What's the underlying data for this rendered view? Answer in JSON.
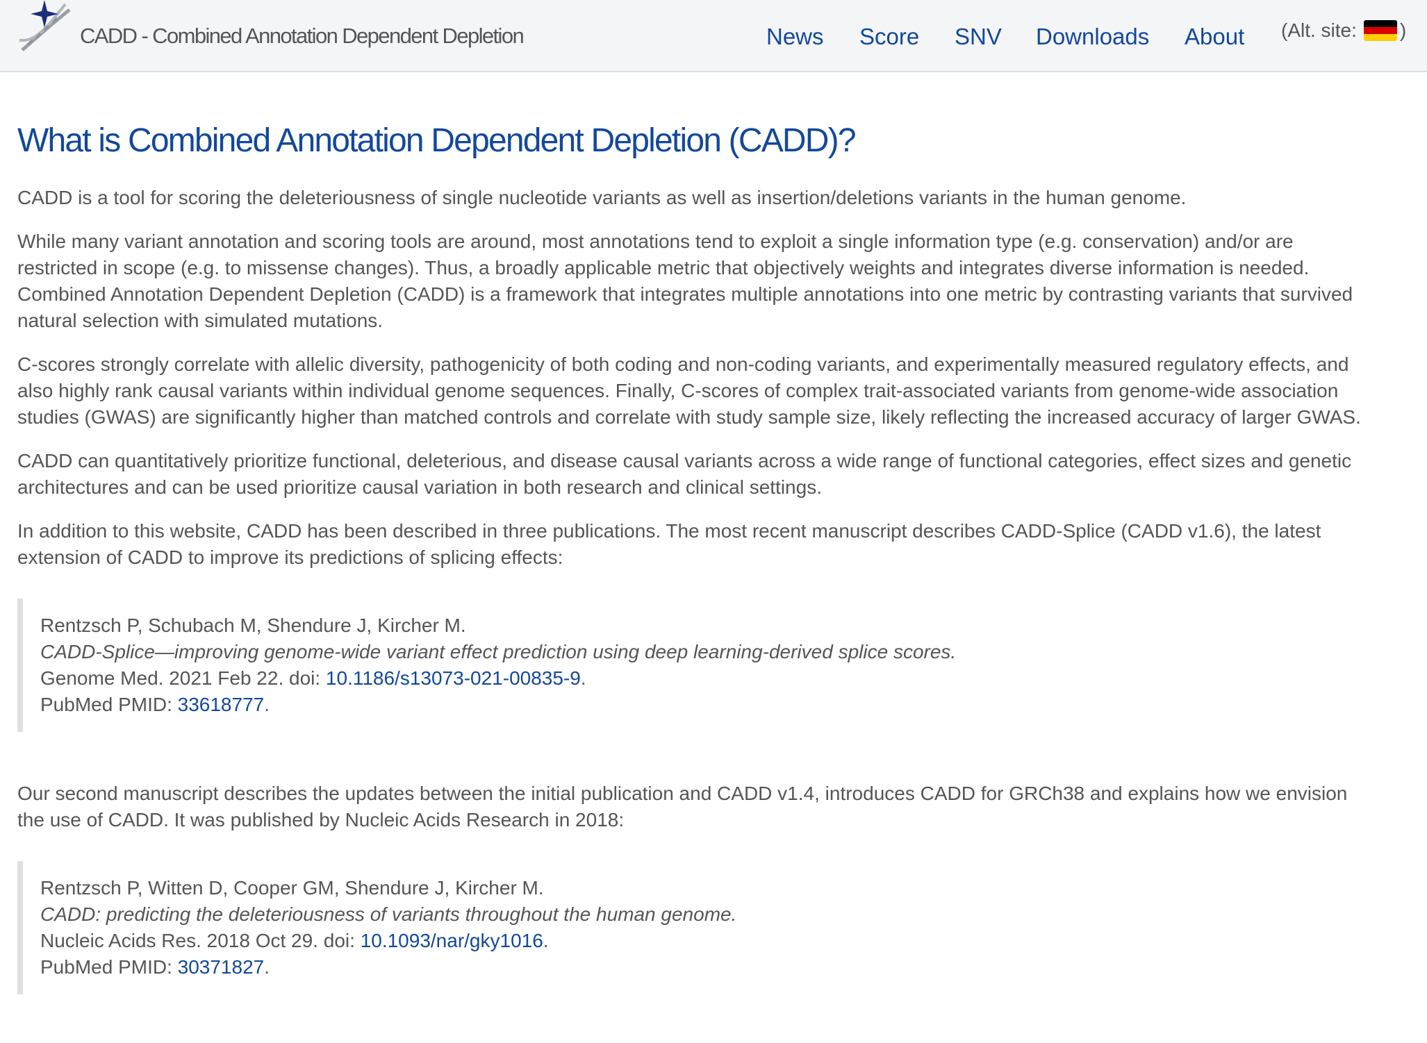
{
  "navbar": {
    "brand": "CADD - Combined Annotation Dependent Depletion",
    "logo_icon": "dna-star-icon",
    "links": [
      "News",
      "Score",
      "SNV",
      "Downloads",
      "About"
    ],
    "alt_site_label": "(Alt. site:",
    "alt_site_close": ")",
    "alt_site_flag": "flag-de-icon"
  },
  "main": {
    "heading": "What is Combined Annotation Dependent Depletion (CADD)?",
    "p1": [
      "CADD is a tool for scoring the deleteriousness of single nucleotide variants as well as insertion/deletions variants in the human genome."
    ],
    "p2": [
      "While many variant annotation and scoring tools are around, most annotations tend to exploit a single information type (e.g. conservation) and/or are",
      "restricted in scope (e.g. to missense changes). Thus, a broadly applicable metric that objectively weights and integrates diverse information is needed.",
      "Combined Annotation Dependent Depletion (CADD) is a framework that integrates multiple annotations into one metric by contrasting variants that survived",
      "natural selection with simulated mutations."
    ],
    "p3": [
      "C-scores strongly correlate with allelic diversity, pathogenicity of both coding and non-coding variants, and experimentally measured regulatory effects, and",
      "also highly rank causal variants within individual genome sequences. Finally, C-scores of complex trait-associated variants from genome-wide association",
      "studies (GWAS) are significantly higher than matched controls and correlate with study sample size, likely reflecting the increased accuracy of larger GWAS."
    ],
    "p4": [
      "CADD can quantitatively prioritize functional, deleterious, and disease causal variants across a wide range of functional categories, effect sizes and genetic",
      "architectures and can be used prioritize causal variation in both research and clinical settings."
    ],
    "p5": [
      "In addition to this website, CADD has been described in three publications. The most recent manuscript describes CADD-Splice (CADD v1.6), the latest",
      "extension of CADD to improve its predictions of splicing effects:"
    ],
    "pub1": {
      "authors": "Rentzsch P, Schubach M, Shendure J, Kircher M.",
      "title": "CADD-Splice—improving genome-wide variant effect prediction using deep learning-derived splice scores.",
      "journal_prefix": "Genome Med. 2021 Feb 22. doi: ",
      "doi": "10.1186/s13073-021-00835-9",
      "pmid_prefix": "PubMed PMID: ",
      "pmid": "33618777",
      "period": "."
    },
    "p6": [
      "Our second manuscript describes the updates between the initial publication and CADD v1.4, introduces CADD for GRCh38 and explains how we envision",
      "the use of CADD. It was published by Nucleic Acids Research in 2018:"
    ],
    "pub2": {
      "authors": "Rentzsch P, Witten D, Cooper GM, Shendure J, Kircher M.",
      "title": "CADD: predicting the deleteriousness of variants throughout the human genome.",
      "journal_prefix": "Nucleic Acids Res. 2018 Oct 29. doi: ",
      "doi": "10.1093/nar/gky1016",
      "pmid_prefix": "PubMed PMID: ",
      "pmid": "30371827",
      "period": "."
    }
  }
}
